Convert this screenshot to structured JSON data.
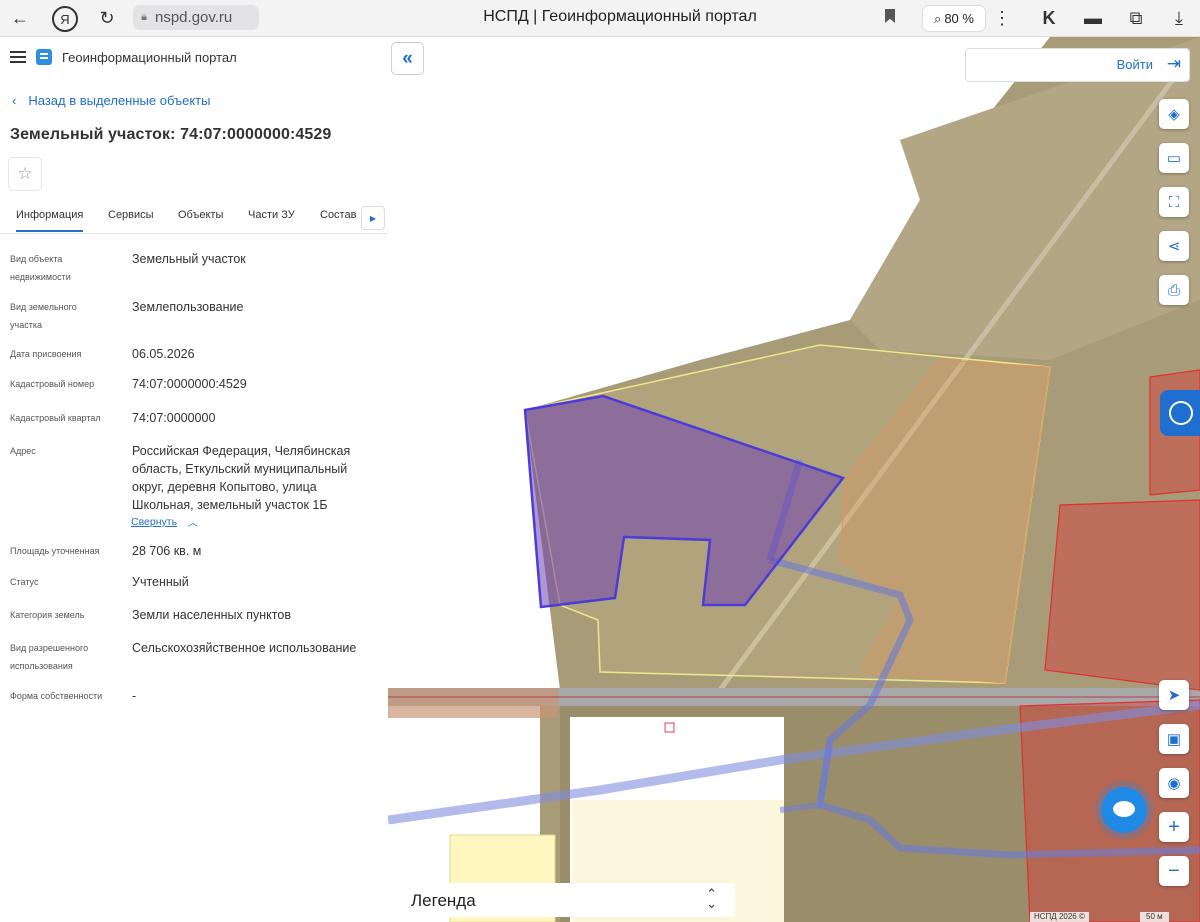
{
  "browser": {
    "url": "nspd.gov.ru",
    "tab_title": "НСПД | Геоинформационный портал",
    "zoom": "80 %"
  },
  "header": {
    "app_title": "Геоинформационный портал"
  },
  "back_link": "Назад в выделенные объекты",
  "page_title": "Земельный участок: 74:07:0000000:4529",
  "tabs": [
    {
      "label": "Информация",
      "active": true
    },
    {
      "label": "Сервисы"
    },
    {
      "label": "Объекты"
    },
    {
      "label": "Части ЗУ"
    },
    {
      "label": "Состав"
    }
  ],
  "properties": [
    {
      "key": "Вид объекта недвижимости",
      "value": "Земельный участок"
    },
    {
      "key": "Вид земельного участка",
      "value": "Землепользование"
    },
    {
      "key": "Дата присвоения",
      "value": "06.05.2026"
    },
    {
      "key": "Кадастровый номер",
      "value": "74:07:0000000:4529"
    },
    {
      "key": "Кадастровый квартал",
      "value": "74:07:0000000"
    },
    {
      "key": "Адрес",
      "value": "Российская Федерация, Челябинская область, Еткульский муниципальный округ, деревня Копытово, улица Школьная, земельный участок 1Б"
    },
    {
      "key": "Площадь уточненная",
      "value": "28 706 кв. м"
    },
    {
      "key": "Статус",
      "value": "Учтенный"
    },
    {
      "key": "Категория земель",
      "value": "Земли населенных пунктов"
    },
    {
      "key": "Вид разрешенного использования",
      "value": "Сельскохозяйственное использование"
    },
    {
      "key": "Форма собственности",
      "value": "-"
    }
  ],
  "collapse_label": "Свернуть",
  "map": {
    "login_label": "Войти",
    "legend_label": "Легенда",
    "attribution": "НСПД 2026 ©",
    "scale_label": "50 м"
  },
  "colors": {
    "accent": "#1f6fd0",
    "selected_parcel": "#7040b0",
    "parcel_outline": "#e8e08a",
    "red_zone": "#d83a3a"
  }
}
